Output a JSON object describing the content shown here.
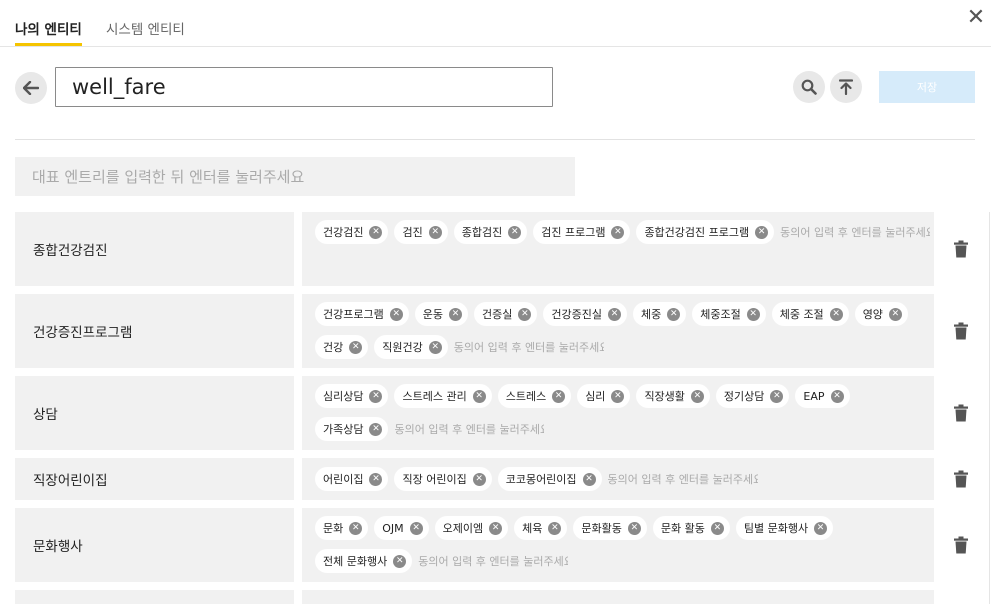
{
  "tabs": [
    {
      "label": "나의 엔티티",
      "active": true
    },
    {
      "label": "시스템 엔티티",
      "active": false
    }
  ],
  "close_icon": "close-icon",
  "entity_name": "well_fare",
  "toolbar": {
    "save_label": "저장",
    "back_icon": "arrow-left-icon",
    "search_icon": "search-icon",
    "upload_icon": "upload-icon"
  },
  "representative_input_placeholder": "대표 엔트리를 입력한 뒤 엔터를 눌러주세요",
  "synonym_input_placeholder": "동의어 입력 후 엔터를 눌러주세요",
  "delete_icon": "trash-icon",
  "entries": [
    {
      "name": "종합건강검진",
      "synonyms": [
        "건강검진",
        "검진",
        "종합검진",
        "검진 프로그램",
        "종합건강검진 프로그램"
      ]
    },
    {
      "name": "건강증진프로그램",
      "synonyms": [
        "건강프로그램",
        "운동",
        "건증실",
        "건강증진실",
        "체중",
        "체중조절",
        "체중 조절",
        "영양",
        "건강",
        "직원건강"
      ]
    },
    {
      "name": "상담",
      "synonyms": [
        "심리상담",
        "스트레스 관리",
        "스트레스",
        "심리",
        "직장생활",
        "정기상담",
        "EAP",
        "가족상담"
      ]
    },
    {
      "name": "직장어린이집",
      "synonyms": [
        "어린이집",
        "직장 어린이집",
        "코코몽어린이집"
      ]
    },
    {
      "name": "문화행사",
      "synonyms": [
        "문화",
        "OJM",
        "오제이엠",
        "체육",
        "문화활동",
        "문화 활동",
        "팀별 문화행사",
        "전체 문화행사"
      ]
    },
    {
      "name": "",
      "synonyms": []
    }
  ],
  "colors": {
    "tab_accent": "#f5c400",
    "save_button_disabled": "#d6ebfa",
    "row_background": "#f1f1f1",
    "chip_remove": "#8a8a8a"
  }
}
